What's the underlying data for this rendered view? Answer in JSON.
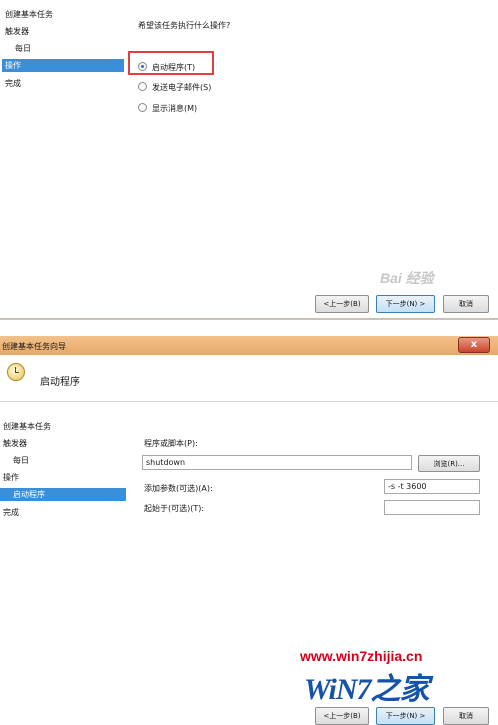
{
  "top_dialog": {
    "sidebar": [
      "创建基本任务",
      "触发器",
      "每日",
      "操作",
      "完成"
    ],
    "question": "希望该任务执行什么操作?",
    "options": [
      {
        "label": "启动程序(T)",
        "checked": true
      },
      {
        "label": "发送电子邮件(S)",
        "checked": false
      },
      {
        "label": "显示消息(M)",
        "checked": false
      }
    ],
    "buttons": {
      "back": "<上一步(B)",
      "next": "下一步(N) >",
      "cancel": "取消"
    },
    "watermark": "Bai 经验"
  },
  "bottom_dialog": {
    "window_title": "创建基本任务向导",
    "close_glyph": "x",
    "header_title": "启动程序",
    "sidebar": [
      "创建基本任务",
      "触发器",
      "每日",
      "操作",
      "启动程序",
      "完成"
    ],
    "program_label": "程序或脚本(P):",
    "program_value": "shutdown",
    "browse_button": "浏览(R)...",
    "args_label": "添加参数(可选)(A):",
    "args_value": "-s -t 3600",
    "start_in_label": "起始于(可选)(T):",
    "start_in_value": "",
    "buttons": {
      "back": "<上一步(B)",
      "next": "下一步(N) >",
      "cancel": "取消"
    },
    "watermark_url": "www.win7zhijia.cn",
    "watermark_logo": "WiN7之家"
  },
  "colors": {
    "selection": "#3a8fd9",
    "highlight_box": "#e04040",
    "titlebar": "#e7a866"
  }
}
